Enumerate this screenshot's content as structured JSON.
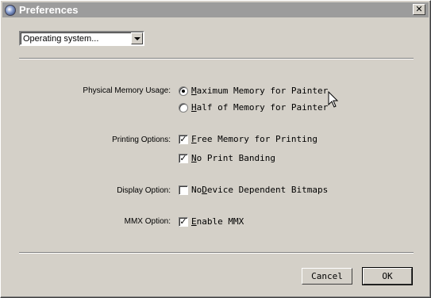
{
  "window": {
    "title": "Preferences",
    "close_glyph": "✕"
  },
  "selector": {
    "value": "Operating system..."
  },
  "sections": {
    "memory": {
      "label": "Physical Memory Usage:",
      "options": [
        {
          "first": "M",
          "rest": "aximum Memory for Painter",
          "selected": true
        },
        {
          "first": "H",
          "rest": "alf of Memory for Painter",
          "selected": false
        }
      ]
    },
    "printing": {
      "label": "Printing Options:",
      "options": [
        {
          "first": "F",
          "rest": "ree Memory for Printing",
          "checked": true
        },
        {
          "first": "N",
          "rest": "o Print Banding",
          "checked": true
        }
      ]
    },
    "display": {
      "label": "Display Option:",
      "option": {
        "pre": "No ",
        "first": "D",
        "rest": "evice Dependent Bitmaps",
        "checked": false
      }
    },
    "mmx": {
      "label": "MMX Option:",
      "option": {
        "pre": "",
        "first": "E",
        "rest": "nable MMX",
        "checked": true
      }
    }
  },
  "buttons": {
    "cancel": "Cancel",
    "ok": "OK"
  },
  "icons": {
    "check_mark": "✓"
  }
}
